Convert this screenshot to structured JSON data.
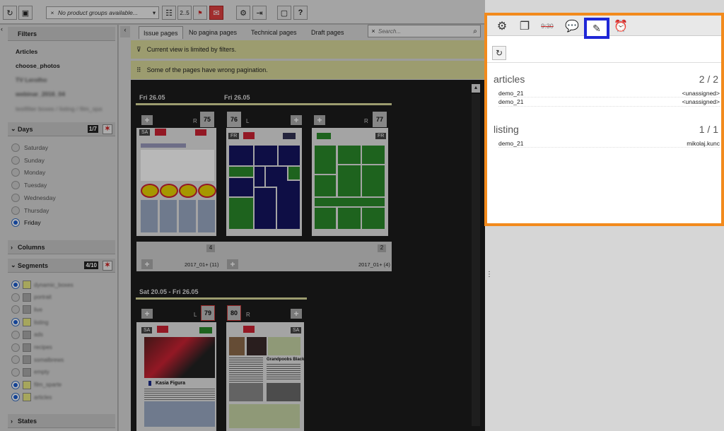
{
  "toolbar": {
    "product_groups_placeholder": "No product groups available...",
    "range_label": "2..5",
    "search_placeholder": "Search..."
  },
  "sidebar": {
    "filters_title": "Filters",
    "filter_items": [
      "Articles",
      "choose_photos",
      "TV Lerolho",
      "webinar_2016_04",
      "testfilter boxes / listing / film_spa"
    ],
    "days_title": "Days",
    "days_count": "1/7",
    "days": [
      {
        "label": "Saturday",
        "on": false
      },
      {
        "label": "Sunday",
        "on": false
      },
      {
        "label": "Monday",
        "on": false
      },
      {
        "label": "Tuesday",
        "on": false
      },
      {
        "label": "Wednesday",
        "on": false
      },
      {
        "label": "Thursday",
        "on": false
      },
      {
        "label": "Friday",
        "on": true
      }
    ],
    "columns_title": "Columns",
    "segments_title": "Segments",
    "segments_count": "4/10",
    "segments": [
      {
        "label": "dynamic_boxes",
        "on": true,
        "color": "#e6e680"
      },
      {
        "label": "portrait",
        "on": false,
        "color": "#aaa"
      },
      {
        "label": "live",
        "on": false,
        "color": "#aaa"
      },
      {
        "label": "listing",
        "on": true,
        "color": "#e6e680"
      },
      {
        "label": "ads",
        "on": false,
        "color": "#aaa"
      },
      {
        "label": "recipes",
        "on": false,
        "color": "#aaa"
      },
      {
        "label": "ssmalbrews",
        "on": false,
        "color": "#aaa"
      },
      {
        "label": "empty",
        "on": false,
        "color": "#aaa"
      },
      {
        "label": "film_sparte",
        "on": true,
        "color": "#e6e680"
      },
      {
        "label": "articles",
        "on": true,
        "color": "#e6e680"
      }
    ],
    "states_title": "States"
  },
  "tabs": [
    "Issue pages",
    "No pagina pages",
    "Technical pages",
    "Draft pages"
  ],
  "notices": {
    "filter": "Current view is limited by filters.",
    "pagination": "Some of the pages have wrong pagination."
  },
  "pages": {
    "group1": {
      "headers": [
        "Fri 26.05",
        "Fri 26.05"
      ],
      "numbers": [
        "75",
        "76",
        "77"
      ],
      "lr": [
        "R",
        "L",
        "R"
      ],
      "counts": [
        "4",
        "2"
      ],
      "footers": [
        "2017_01+ (11)",
        "2017_01+ (4)"
      ],
      "badges": [
        "SA",
        "FR",
        "FR"
      ]
    },
    "group2": {
      "header": "Sat 20.05 - Fri 26.05",
      "numbers": [
        "79",
        "80"
      ],
      "lr": [
        "L",
        "R"
      ],
      "badges": [
        "SA",
        "SA"
      ],
      "headline": "Kasia Figura",
      "subheadline": "Grandpoobs Black"
    }
  },
  "panel": {
    "time_icon_label": "9:30",
    "groups": [
      {
        "title": "articles",
        "count": "2 / 2",
        "rows": [
          {
            "name": "demo_21",
            "user": "<unassigned>"
          },
          {
            "name": "demo_21",
            "user": "<unassigned>"
          }
        ]
      },
      {
        "title": "listing",
        "count": "1 / 1",
        "rows": [
          {
            "name": "demo_21",
            "user": "mikolaj.kunc"
          }
        ]
      }
    ]
  },
  "colors": {
    "accent_orange": "#f28a1c",
    "highlight_blue": "#1f27d6",
    "notice_bg": "#d8d89a"
  }
}
